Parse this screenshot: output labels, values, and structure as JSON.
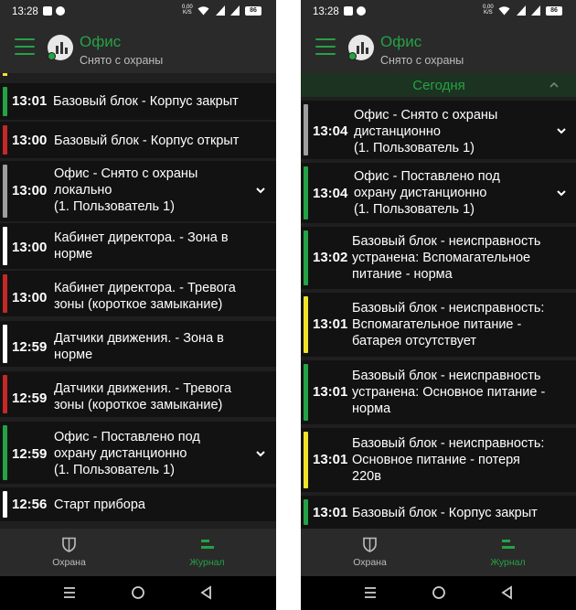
{
  "status_bar": {
    "time": "13:28",
    "speed": "0,00\nK/S",
    "net1": "4G",
    "net2": "4G",
    "battery": "86"
  },
  "header": {
    "title": "Офис",
    "subtitle": "Снято с охраны"
  },
  "colors": {
    "green": "#25a244",
    "red": "#c62828",
    "white": "#ffffff",
    "gray": "#9e9e9e",
    "yellow": "#f2e12b"
  },
  "left_events": [
    {
      "time": "13:01",
      "text": "Базовый блок - Корпус закрыт",
      "color": "green"
    },
    {
      "time": "13:00",
      "text": "Базовый блок - Корпус открыт",
      "color": "red"
    },
    {
      "time": "13:00",
      "text": "Офис - Снято с охраны\nлокально\n(1. Пользователь 1)",
      "color": "gray",
      "expandable": true
    },
    {
      "time": "13:00",
      "text": "Кабинет директора. - Зона в\nнорме",
      "color": "white"
    },
    {
      "time": "13:00",
      "text": "Кабинет директора. - Тревога\nзоны (короткое замыкание)",
      "color": "red"
    },
    {
      "time": "12:59",
      "text": "Датчики движения. - Зона в\nнорме",
      "color": "white"
    },
    {
      "time": "12:59",
      "text": "Датчики движения. - Тревога\nзоны (короткое замыкание)",
      "color": "red"
    },
    {
      "time": "12:59",
      "text": "Офис - Поставлено под\nохрану дистанционно\n(1. Пользователь 1)",
      "color": "green",
      "expandable": true
    },
    {
      "time": "12:56",
      "text": "Старт прибора",
      "color": "white"
    }
  ],
  "right_section": {
    "label": "Сегодня"
  },
  "right_events": [
    {
      "time": "13:04",
      "text": "Офис - Снято с охраны\nдистанционно\n(1. Пользователь 1)",
      "color": "gray",
      "expandable": true
    },
    {
      "time": "13:04",
      "text": "Офис - Поставлено под\nохрану дистанционно\n(1. Пользователь 1)",
      "color": "green",
      "expandable": true
    },
    {
      "time": "13:02",
      "text": "Базовый блок - неисправность\nустранена: Вспомагательное\nпитание - норма",
      "color": "green"
    },
    {
      "time": "13:01",
      "text": "Базовый блок - неисправность:\nВспомагательное питание -\nбатарея отсутствует",
      "color": "yellow"
    },
    {
      "time": "13:01",
      "text": "Базовый блок - неисправность\nустранена: Основное питание -\nнорма",
      "color": "green"
    },
    {
      "time": "13:01",
      "text": "Базовый блок - неисправность:\nОсновное питание - потеря\n220в",
      "color": "yellow"
    },
    {
      "time": "13:01",
      "text": "Базовый блок - Корпус закрыт",
      "color": "green"
    }
  ],
  "bottom_nav": [
    {
      "label": "Охрана",
      "icon": "shield-icon",
      "active": false
    },
    {
      "label": "Журнал",
      "icon": "journal-icon",
      "active": true
    }
  ]
}
